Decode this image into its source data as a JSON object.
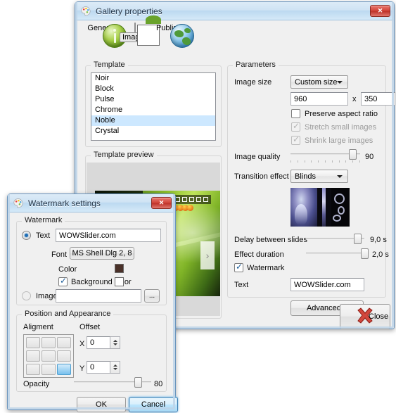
{
  "gallery_window": {
    "title": "Gallery properties",
    "app_icon": "palette-icon",
    "close_label": "✕",
    "toolbar": [
      {
        "label": "General",
        "icon": "info-orb-icon",
        "selected": false
      },
      {
        "label": "Images",
        "icon": "photo-icon",
        "selected": true
      },
      {
        "label": "Publish",
        "icon": "globe-orb-icon",
        "selected": false
      }
    ],
    "template_group": {
      "label": "Template",
      "items": [
        "Noir",
        "Block",
        "Pulse",
        "Chrome",
        "Noble",
        "Crystal"
      ],
      "selected": "Noble"
    },
    "preview_group": {
      "label": "Template preview",
      "nav_arrow": "›"
    },
    "parameters_group": {
      "label": "Parameters",
      "image_size_label": "Image size",
      "image_size_value": "Custom size",
      "width_value": "960",
      "x_separator": "x",
      "height_value": "350",
      "preserve_aspect_ratio": {
        "label": "Preserve aspect ratio",
        "checked": false,
        "enabled": true
      },
      "stretch_small_images": {
        "label": "Stretch small images",
        "checked": true,
        "enabled": false
      },
      "shrink_large_images": {
        "label": "Shrink large images",
        "checked": true,
        "enabled": false
      },
      "image_quality_label": "Image quality",
      "image_quality_value": "90",
      "transition_effect_label": "Transition effect",
      "transition_effect_value": "Blinds",
      "delay_label": "Delay between slides",
      "delay_value": "9,0 s",
      "effect_duration_label": "Effect duration",
      "effect_duration_value": "2,0 s",
      "watermark_checkbox": {
        "label": "Watermark",
        "checked": true
      },
      "text_label": "Text",
      "text_value": "WOWSlider.com",
      "advanced_button": "Advanced..."
    },
    "close_button": {
      "label": "Close",
      "icon": "red-x-icon"
    }
  },
  "watermark_window": {
    "title": "Watermark settings",
    "app_icon": "palette-icon",
    "close_label": "✕",
    "watermark_group": {
      "label": "Watermark",
      "text_radio_label": "Text",
      "text_radio_selected": true,
      "text_value": "WOWSlider.com",
      "font_label": "Font",
      "font_button_value": "MS Shell Dlg 2, 8",
      "color_label": "Color",
      "color_value": "#4a3129",
      "background_color_label": "Background color",
      "background_color_checked": true,
      "background_color_value": "#ffffff",
      "image_radio_label": "Image",
      "image_radio_selected": false,
      "image_path_value": "",
      "browse_button": "..."
    },
    "position_group": {
      "label": "Position and Appearance",
      "alignment_label": "Aligment",
      "alignment_selected_cell": "bottom-right",
      "offset_label": "Offset",
      "x_label": "X",
      "x_value": "0",
      "y_label": "Y",
      "y_value": "0",
      "opacity_label": "Opacity",
      "opacity_value": "80"
    },
    "ok_button": "OK",
    "cancel_button": "Cancel"
  }
}
